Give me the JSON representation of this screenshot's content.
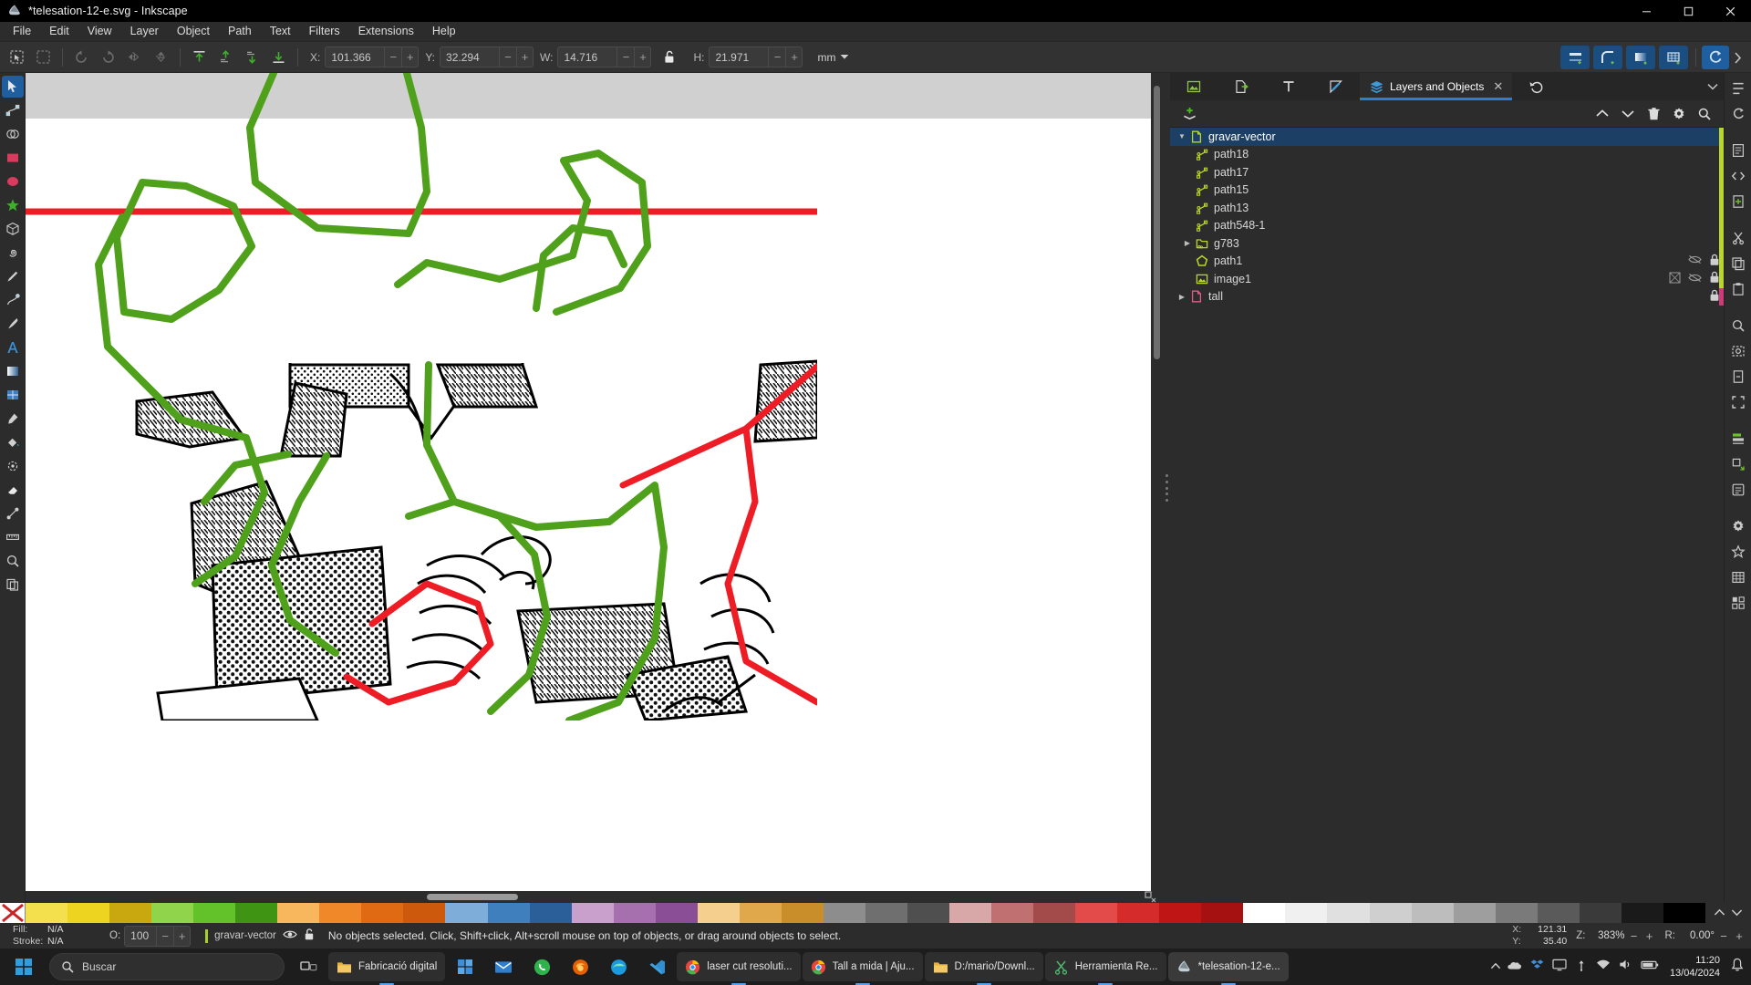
{
  "window": {
    "title": "*telesation-12-e.svg - Inkscape",
    "app_icon": "inkscape-logo-icon",
    "buttons": {
      "minimize": "minimize-icon",
      "maximize": "maximize-icon",
      "close": "close-icon"
    }
  },
  "menu": {
    "items": [
      {
        "label": "File"
      },
      {
        "label": "Edit"
      },
      {
        "label": "View"
      },
      {
        "label": "Layer"
      },
      {
        "label": "Object"
      },
      {
        "label": "Path"
      },
      {
        "label": "Text"
      },
      {
        "label": "Filters"
      },
      {
        "label": "Extensions"
      },
      {
        "label": "Help"
      }
    ]
  },
  "toolbar": {
    "select_all_label": "select-all-icon",
    "select_none_label": "deselect-icon",
    "rotate_ccw": "rotate-ccw-icon",
    "rotate_cw": "rotate-cw-icon",
    "flip_h": "flip-horizontal-icon",
    "flip_v": "flip-vertical-icon",
    "raise_top": "raise-to-top-icon",
    "raise": "raise-icon",
    "lower": "lower-icon",
    "lower_bottom": "lower-to-bottom-icon",
    "fields": {
      "x": {
        "label": "X:",
        "value": "101.366"
      },
      "y": {
        "label": "Y:",
        "value": "32.294"
      },
      "w": {
        "label": "W:",
        "value": "14.716"
      },
      "h": {
        "label": "H:",
        "value": "21.971"
      }
    },
    "lock_ratio": "unlocked-padlock-icon",
    "units": {
      "value": "mm",
      "chevron": "chevron-down-icon"
    },
    "affect_buttons": [
      "affect-stroke-width-icon",
      "affect-rounded-corners-icon",
      "affect-gradients-icon",
      "affect-patterns-icon"
    ],
    "snap_toggle": "snap-enable-icon",
    "overflow": "chevron-right-icon"
  },
  "toolbox": {
    "tools": [
      {
        "name": "selector-tool",
        "icon": "arrow-cursor-icon",
        "active": true
      },
      {
        "name": "node-tool",
        "icon": "node-editor-icon",
        "active": false
      },
      {
        "name": "shape-builder-tool",
        "icon": "shape-builder-icon",
        "active": false
      },
      {
        "name": "rectangle-tool",
        "icon": "rectangle-icon",
        "active": false
      },
      {
        "name": "ellipse-tool",
        "icon": "ellipse-icon",
        "active": false
      },
      {
        "name": "star-tool",
        "icon": "star-icon",
        "active": false
      },
      {
        "name": "3dbox-tool",
        "icon": "cube-icon",
        "active": false
      },
      {
        "name": "spiral-tool",
        "icon": "spiral-icon",
        "active": false
      },
      {
        "name": "pencil-tool",
        "icon": "pencil-icon",
        "active": false
      },
      {
        "name": "pen-tool",
        "icon": "bezier-pen-icon",
        "active": false
      },
      {
        "name": "calligraphy-tool",
        "icon": "calligraphy-icon",
        "active": false
      },
      {
        "name": "text-tool",
        "icon": "text-a-icon",
        "active": false
      },
      {
        "name": "gradient-tool",
        "icon": "gradient-icon",
        "active": false
      },
      {
        "name": "mesh-tool",
        "icon": "mesh-gradient-icon",
        "active": false
      },
      {
        "name": "dropper-tool",
        "icon": "eyedropper-icon",
        "active": false
      },
      {
        "name": "paintbucket-tool",
        "icon": "paint-bucket-icon",
        "active": false
      },
      {
        "name": "tweak-tool",
        "icon": "tweak-icon",
        "active": false
      },
      {
        "name": "eraser-tool",
        "icon": "eraser-icon",
        "active": false
      },
      {
        "name": "connector-tool",
        "icon": "connector-icon",
        "active": false
      },
      {
        "name": "measure-tool",
        "icon": "measure-ruler-icon",
        "active": false
      },
      {
        "name": "zoom-tool",
        "icon": "magnifier-icon",
        "active": false
      },
      {
        "name": "pages-tool",
        "icon": "pages-icon",
        "active": false
      }
    ]
  },
  "panel": {
    "tabs": [
      {
        "name": "tab-objects-image",
        "icon": "image-properties-icon",
        "label": "",
        "active": false
      },
      {
        "name": "tab-export",
        "icon": "export-icon",
        "label": "",
        "active": false
      },
      {
        "name": "tab-text",
        "icon": "text-t-icon",
        "label": "",
        "active": false
      },
      {
        "name": "tab-fill-stroke",
        "icon": "fill-stroke-pen-icon",
        "label": "",
        "active": false
      },
      {
        "name": "tab-layers-objects",
        "icon": "layers-icon",
        "label": "Layers and Objects",
        "active": true
      }
    ],
    "tab_extra": "undo-history-icon",
    "overflow_icon": "chevron-down-icon",
    "toolbar": {
      "add_layer": "add-layer-icon",
      "move_up": "chevron-up-icon",
      "move_down": "chevron-down-icon",
      "delete": "trash-icon",
      "settings": "gear-icon",
      "search": "search-icon"
    },
    "tree": [
      {
        "label": "gravar-vector",
        "icon": "layer-icon",
        "indent": 0,
        "twisty": "open",
        "selected": true,
        "locked": false,
        "strip": "#b9d62a"
      },
      {
        "label": "path18",
        "icon": "path-node-icon",
        "indent": 1,
        "twisty": "none",
        "selected": false,
        "locked": false,
        "strip": "#b9d62a"
      },
      {
        "label": "path17",
        "icon": "path-node-icon",
        "indent": 1,
        "twisty": "none",
        "selected": false,
        "locked": false,
        "strip": "#b9d62a"
      },
      {
        "label": "path15",
        "icon": "path-node-icon",
        "indent": 1,
        "twisty": "none",
        "selected": false,
        "locked": false,
        "strip": "#b9d62a"
      },
      {
        "label": "path13",
        "icon": "path-node-icon",
        "indent": 1,
        "twisty": "none",
        "selected": false,
        "locked": false,
        "strip": "#b9d62a"
      },
      {
        "label": "path548-1",
        "icon": "path-node-icon",
        "indent": 1,
        "twisty": "none",
        "selected": false,
        "locked": false,
        "strip": "#b9d62a"
      },
      {
        "label": "g783",
        "icon": "group-folder-icon",
        "indent": 1,
        "twisty": "closed",
        "selected": false,
        "locked": false,
        "strip": "#b9d62a"
      },
      {
        "label": "path1",
        "icon": "pentagon-path-icon",
        "indent": 1,
        "twisty": "none",
        "selected": false,
        "locked": true,
        "clip": false,
        "strip": "#b9d62a"
      },
      {
        "label": "image1",
        "icon": "image-item-icon",
        "indent": 1,
        "twisty": "none",
        "selected": false,
        "locked": true,
        "clip": true,
        "strip": "#b9d62a"
      },
      {
        "label": "tall",
        "icon": "layer-icon",
        "indent": 0,
        "twisty": "closed",
        "selected": false,
        "locked": true,
        "strip": "#cf3a7a"
      }
    ]
  },
  "rail": {
    "items": [
      "command-bar-icon",
      "snap-controls-icon",
      "document-properties-icon",
      "xml-editor-icon",
      "new-from-template-icon",
      "cut-icon",
      "copy-icon",
      "paste-icon",
      "zoom-drawing-icon",
      "zoom-selection-icon",
      "zoom-page-icon",
      "zoom-fit-icon",
      "align-distribute-icon",
      "transform-icon",
      "object-properties-icon",
      "preferences-gear-icon",
      "symbols-icon",
      "paint-servers-icon",
      "clone-tiles-icon"
    ]
  },
  "canvas": {
    "artwork_name": "laser-cut-vector-drawing",
    "colors": {
      "green": "#4fa01a",
      "red": "#ee1c24",
      "black": "#000000",
      "paper": "#ffffff",
      "desk": "#d0d0d0"
    }
  },
  "palette": {
    "no_color_icon": "no-color-x-icon",
    "swatches": [
      "#f4e04d",
      "#ecd420",
      "#c9a80f",
      "#8fd44a",
      "#63c22a",
      "#3f9414",
      "#f8b75c",
      "#f0882a",
      "#e06a13",
      "#cd5a0c",
      "#7fadd9",
      "#3f7fbe",
      "#2a5f99",
      "#c99fcb",
      "#a66fae",
      "#8a4e96",
      "#f5cf8e",
      "#e0a84b",
      "#c98e2a",
      "#8d8d8d",
      "#6f6f6f",
      "#4f4f4f",
      "#d8a7a7",
      "#c07070",
      "#a34b4b",
      "#e34b4b",
      "#d52b2b",
      "#c01515",
      "#a51010",
      "#ffffff",
      "#f0f0f0",
      "#e0e0e0",
      "#cfcfcf",
      "#bdbdbd",
      "#9e9e9e",
      "#7a7a7a",
      "#5a5a5a",
      "#3a3a3a",
      "#1a1a1a",
      "#000000"
    ],
    "up_arrow": "chevron-up-icon",
    "down_arrow": "chevron-down-icon"
  },
  "statusbar": {
    "fill": {
      "label": "Fill:",
      "value": "N/A"
    },
    "stroke": {
      "label": "Stroke:",
      "value": "N/A"
    },
    "opacity": {
      "label": "O:",
      "value": "100"
    },
    "layer_name": "gravar-vector",
    "layer_visibility_icon": "eye-open-icon",
    "layer_lock_icon": "unlocked-padlock-icon",
    "message": "No objects selected. Click, Shift+click, Alt+scroll mouse on top of objects, or drag around objects to select.",
    "cursor": {
      "x_label": "X:",
      "x_value": "121.31",
      "y_label": "Y:",
      "y_value": "35.40"
    },
    "zoom": {
      "label": "Z:",
      "value": "383%",
      "minus": "minus-icon",
      "plus": "plus-icon"
    },
    "rotation": {
      "label": "R:",
      "value": "0.00°",
      "minus": "minus-icon",
      "plus": "plus-icon"
    }
  },
  "taskbar": {
    "start_icon": "windows-start-icon",
    "search": {
      "placeholder": "Buscar",
      "icon": "search-icon"
    },
    "task_view_icon": "task-view-icon",
    "pinned": [
      {
        "name": "file-explorer",
        "icon": "folder-icon",
        "label": "Fabricació digital"
      },
      {
        "name": "widgets",
        "icon": "widgets-icon",
        "label": ""
      },
      {
        "name": "mail",
        "icon": "mail-icon",
        "label": ""
      },
      {
        "name": "whatsapp",
        "icon": "whatsapp-icon",
        "label": ""
      },
      {
        "name": "firefox",
        "icon": "firefox-icon",
        "label": ""
      },
      {
        "name": "edge",
        "icon": "edge-icon",
        "label": ""
      },
      {
        "name": "vscode",
        "icon": "vscode-icon",
        "label": ""
      }
    ],
    "windows": [
      {
        "name": "chrome-laser-cut",
        "icon": "chrome-icon",
        "label": "laser cut resoluti..."
      },
      {
        "name": "chrome-tall-a-mida",
        "icon": "chrome-icon",
        "label": "Tall a mida | Aju..."
      },
      {
        "name": "explorer-downloads",
        "icon": "folder-icon",
        "label": "D:/mario/Downl..."
      },
      {
        "name": "herramienta-recortes",
        "icon": "snipping-tool-icon",
        "label": "Herramienta Re..."
      },
      {
        "name": "inkscape-window",
        "icon": "inkscape-logo-icon",
        "label": "*telesation-12-e...",
        "active": true
      }
    ],
    "tray": {
      "icons": [
        "tray-chevron-icon",
        "onedrive-icon",
        "dropbox-icon",
        "display-icon",
        "usb-icon",
        "network-icon",
        "sound-icon",
        "battery-icon"
      ],
      "wifi": "wifi-icon",
      "volume": "volume-icon",
      "time": "11:20",
      "date": "13/04/2024",
      "notification_icon": "notification-bell-icon"
    }
  }
}
